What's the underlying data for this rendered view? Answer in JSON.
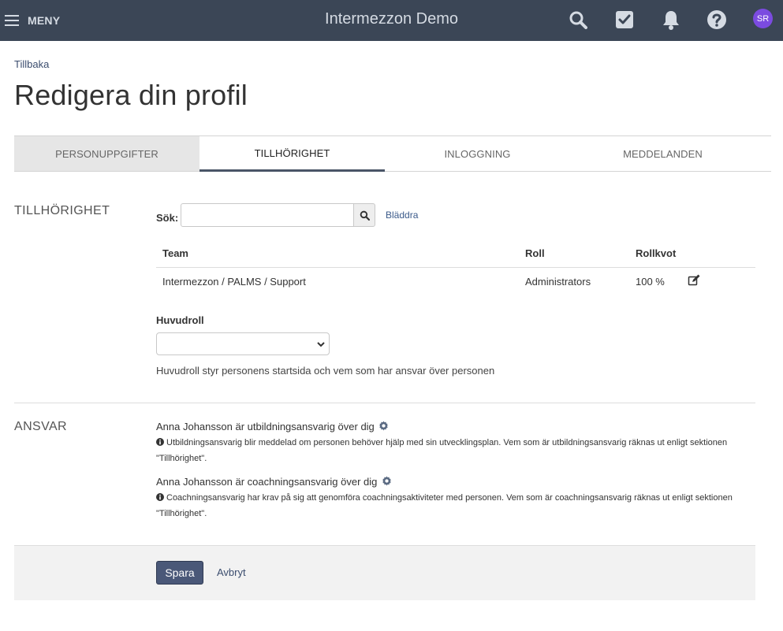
{
  "topbar": {
    "menu_label": "MENY",
    "app_title": "Intermezzon Demo",
    "icons": [
      "search-icon",
      "tasks-check-icon",
      "bell-icon",
      "help-icon"
    ],
    "avatar_initials": "SR",
    "colors": {
      "bar": "#3b4656",
      "icon": "#d5dbe3",
      "avatar": "#7b4be0"
    }
  },
  "header": {
    "back_label": "Tillbaka",
    "title": "Redigera din profil"
  },
  "tabs": [
    {
      "label": "PERSONUPPGIFTER",
      "state": "grey"
    },
    {
      "label": "TILLHÖRIGHET",
      "state": "active"
    },
    {
      "label": "INLOGGNING",
      "state": "normal"
    },
    {
      "label": "MEDDELANDEN",
      "state": "normal"
    }
  ],
  "affiliation": {
    "section_label": "TILLHÖRIGHET",
    "search_label": "Sök:",
    "search_value": "",
    "browse_label": "Bläddra",
    "table": {
      "headers": {
        "team": "Team",
        "role": "Roll",
        "quota": "Rollkvot"
      },
      "rows": [
        {
          "team": "Intermezzon / PALMS / Support",
          "role": "Administrators",
          "quota": "100 %"
        }
      ]
    },
    "main_role_label": "Huvudroll",
    "main_role_selected": "",
    "main_role_help": "Huvudroll styr personens startsida och vem som har ansvar över personen"
  },
  "responsibility": {
    "section_label": "ANSVAR",
    "education": {
      "line": "Anna Johansson är utbildningsansvarig över dig",
      "note": "Utbildningsansvarig blir meddelad om personen behöver hjälp med sin utvecklingsplan. Vem som är utbildningsansvarig räknas ut enligt sektionen \"Tillhörighet\"."
    },
    "coaching": {
      "line": "Anna Johansson är coachningsansvarig över dig",
      "note": "Coachningsansvarig har krav på sig att genomföra coachningsaktiviteter med personen. Vem som är coachningsansvarig räknas ut enligt sektionen \"Tillhörighet\"."
    }
  },
  "footer": {
    "save_label": "Spara",
    "cancel_label": "Avbryt"
  }
}
